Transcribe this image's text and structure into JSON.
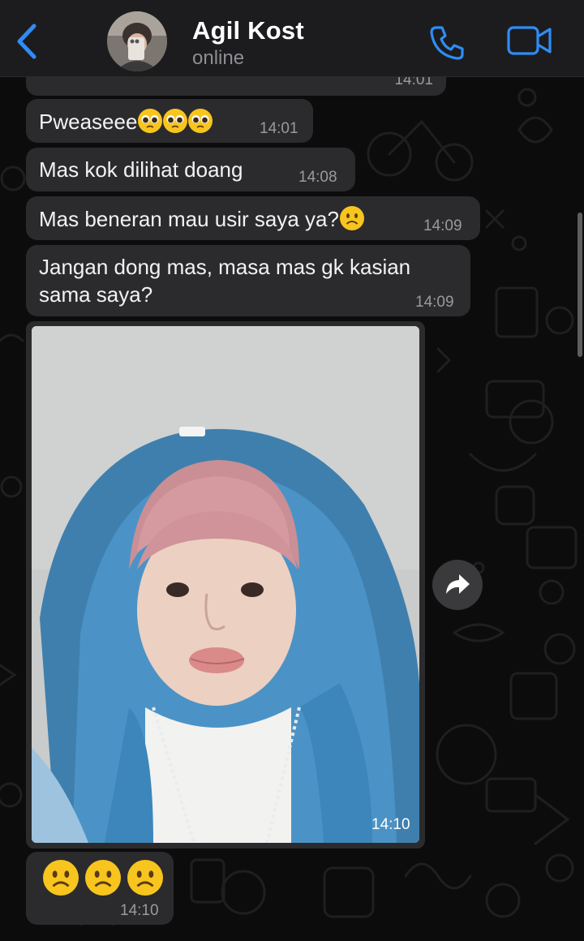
{
  "header": {
    "contact_name": "Agil Kost",
    "status": "online"
  },
  "messages": [
    {
      "id": "m0",
      "text": "",
      "time": "14:01"
    },
    {
      "id": "m1",
      "text": "Pweaseee",
      "emoji": [
        "pleading-face-emoji",
        "pleading-face-emoji",
        "pleading-face-emoji"
      ],
      "time": "14:01"
    },
    {
      "id": "m2",
      "text": "Mas kok dilihat doang",
      "time": "14:08"
    },
    {
      "id": "m3",
      "text": "Mas beneran mau usir saya ya?",
      "emoji": [
        "frowning-face-emoji"
      ],
      "time": "14:09"
    },
    {
      "id": "m4",
      "text_line1": "Jangan dong mas, masa mas gk kasian",
      "text_line2": "sama saya?",
      "time": "14:09"
    },
    {
      "id": "m5",
      "type": "photo",
      "time": "14:10"
    },
    {
      "id": "m6",
      "type": "emoji-only",
      "emoji": [
        "frowning-face-emoji",
        "frowning-face-emoji",
        "frowning-face-emoji"
      ],
      "time": "14:10"
    }
  ],
  "icons": {
    "back": "chevron-left-icon",
    "call": "phone-icon",
    "video": "video-camera-icon",
    "share": "forward-arrow-icon"
  },
  "colors": {
    "accent": "#2f8cf5",
    "bubble": "#2b2b2d",
    "header": "#1c1c1e",
    "emoji": "#f7c51e"
  }
}
